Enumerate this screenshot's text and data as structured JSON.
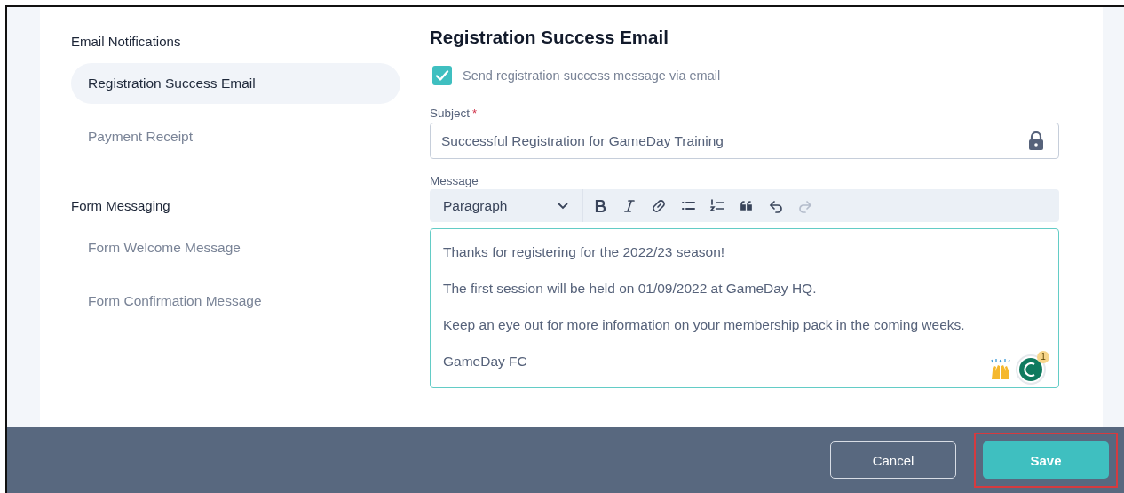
{
  "sidebar": {
    "sections": [
      {
        "heading": "Email Notifications",
        "items": [
          {
            "label": "Registration Success Email",
            "selected": true
          },
          {
            "label": "Payment Receipt",
            "selected": false
          }
        ]
      },
      {
        "heading": "Form Messaging",
        "items": [
          {
            "label": "Form Welcome Message",
            "selected": false
          },
          {
            "label": "Form Confirmation Message",
            "selected": false
          }
        ]
      }
    ]
  },
  "main": {
    "title": "Registration Success Email",
    "send_checkbox": {
      "label": "Send registration success message via email",
      "checked": true
    },
    "subject": {
      "label": "Subject",
      "required_mark": "*",
      "value": "Successful Registration for GameDay Training",
      "locked": true
    },
    "message": {
      "label": "Message",
      "block_format": "Paragraph",
      "toolbar": [
        {
          "kind": "bold",
          "disabled": false
        },
        {
          "kind": "italic",
          "disabled": false
        },
        {
          "kind": "link",
          "disabled": false
        },
        {
          "kind": "bullets",
          "disabled": false
        },
        {
          "kind": "numbers",
          "disabled": false
        },
        {
          "kind": "quote",
          "disabled": false
        },
        {
          "kind": "undo",
          "disabled": false
        },
        {
          "kind": "redo",
          "disabled": true
        }
      ],
      "paragraphs": [
        "Thanks for registering for the 2022/23 season!",
        "The first session will be held on 01/09/2022 at GameDay HQ.",
        "Keep an eye out for more information on your membership pack in the coming weeks.",
        "GameDay FC"
      ],
      "assistant_badge": "1"
    }
  },
  "footer": {
    "buttons": [
      {
        "label": "Cancel",
        "kind": "secondary",
        "highlighted": false
      },
      {
        "label": "Save",
        "kind": "primary",
        "highlighted": true
      }
    ]
  }
}
